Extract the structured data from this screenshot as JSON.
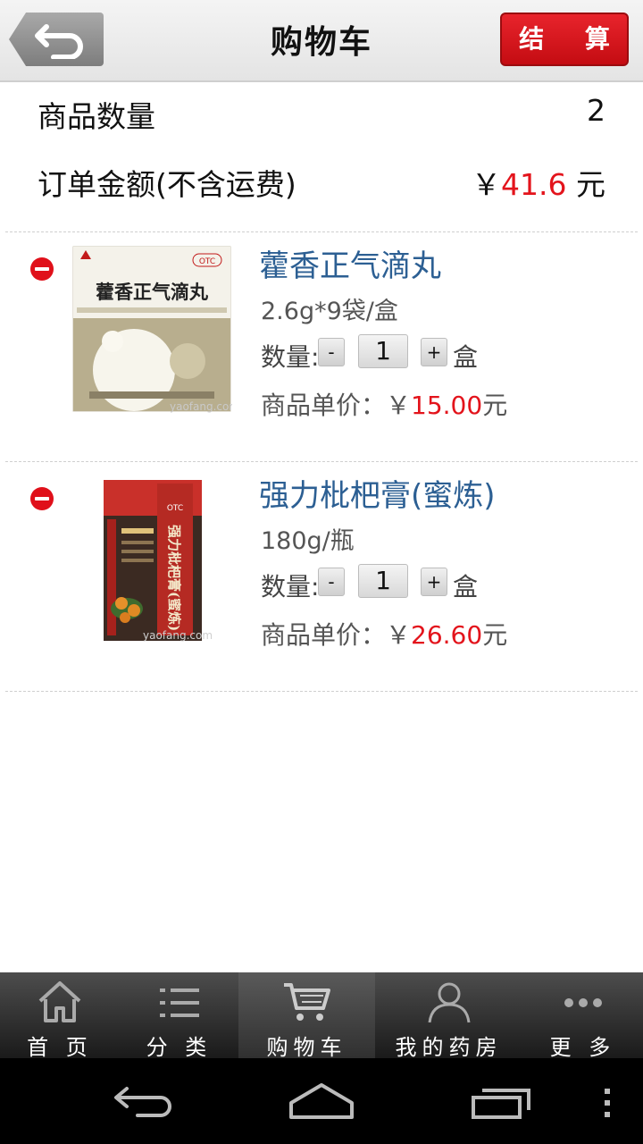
{
  "header": {
    "title": "购物车",
    "checkout_label": "结 算"
  },
  "summary": {
    "count_label": "商品数量",
    "count_value": "2",
    "total_label": "订单金额(不含运费)",
    "total_currency": "￥",
    "total_value": "41.6",
    "total_unit": "元"
  },
  "items": [
    {
      "name": "藿香正气滴丸",
      "spec": "2.6g*9袋/盒",
      "qty_label": "数量:",
      "qty_minus": "-",
      "qty_value": "1",
      "qty_plus": "+",
      "qty_unit": "盒",
      "price_label": "商品单价：￥",
      "price_value": "15.00",
      "price_unit": "元",
      "box_title": "藿香正气滴丸",
      "box_badge": "OTC",
      "watermark": "yaofang.com"
    },
    {
      "name": "强力枇杷膏(蜜炼)",
      "spec": "180g/瓶",
      "qty_label": "数量:",
      "qty_minus": "-",
      "qty_value": "1",
      "qty_plus": "+",
      "qty_unit": "盒",
      "price_label": "商品单价：￥",
      "price_value": "26.60",
      "price_unit": "元",
      "box_title": "强力枇杷膏(蜜炼)",
      "box_badge": "OTC",
      "watermark": "yaofang.com"
    }
  ],
  "nav": [
    {
      "label": "首 页",
      "icon": "home-icon"
    },
    {
      "label": "分 类",
      "icon": "list-icon"
    },
    {
      "label": "购物车",
      "icon": "cart-icon",
      "active": true
    },
    {
      "label": "我的药房",
      "icon": "user-icon"
    },
    {
      "label": "更 多",
      "icon": "more-icon"
    }
  ],
  "colors": {
    "accent_red": "#e3141c",
    "item_name_blue": "#2c5f93"
  }
}
